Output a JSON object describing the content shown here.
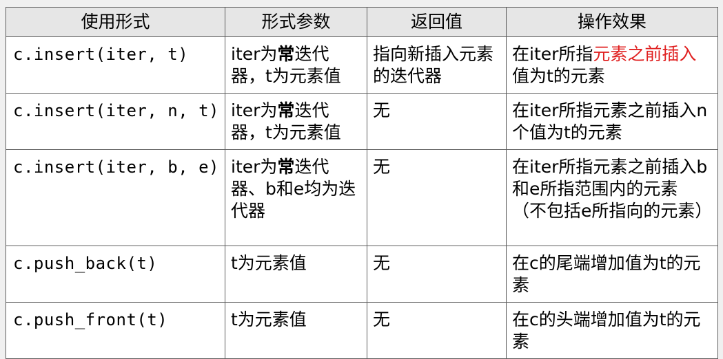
{
  "headers": [
    "使用形式",
    "形式参数",
    "返回值",
    "操作效果"
  ],
  "rows": [
    {
      "usage": "c.insert(iter, t)",
      "params": {
        "pre": "iter为",
        "bold": "常",
        "post": "迭代器，t为元素值"
      },
      "ret": "指向新插入元素的迭代器",
      "effect": {
        "pre": "在iter所指",
        "red": "元素之前插入",
        "post": "值为t的元素"
      }
    },
    {
      "usage": "c.insert(iter, n, t)",
      "params": {
        "pre": "iter为",
        "bold": "常",
        "post": "迭代器，t为元素值"
      },
      "ret": "无",
      "effect": "在iter所指元素之前插入n个值为t的元素"
    },
    {
      "usage": "c.insert(iter, b, e)",
      "params": {
        "pre": "iter为",
        "bold": "常",
        "post": "迭代器、b和e均为迭代器"
      },
      "ret": "无",
      "effect": "在iter所指元素之前插入b和e所指范围内的元素（不包括e所指向的元素）"
    },
    {
      "usage": "c.push_back(t)",
      "params": "t为元素值",
      "ret": "无",
      "effect": "在c的尾端增加值为t的元素"
    },
    {
      "usage": "c.push_front(t)",
      "params": "t为元素值",
      "ret": "无",
      "effect": "在c的头端增加值为t的元素"
    }
  ]
}
